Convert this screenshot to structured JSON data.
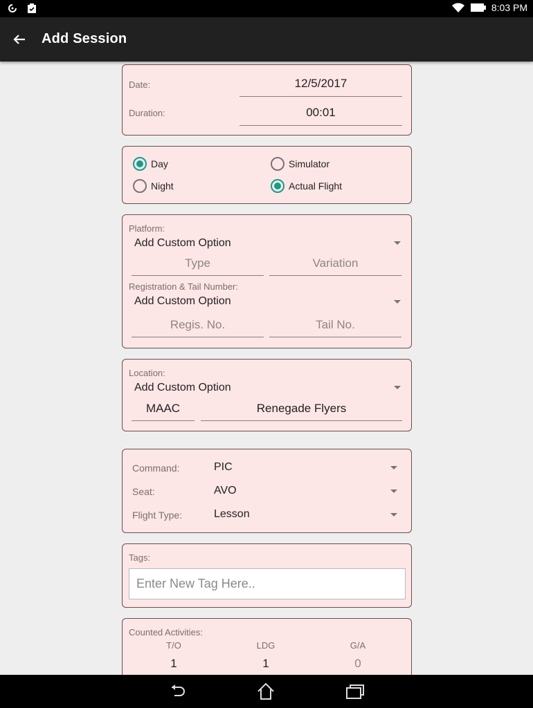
{
  "status_bar": {
    "time": "8:03 PM",
    "left_icons": [
      "sync-icon",
      "clipboard-check-icon"
    ],
    "right_icons": [
      "wifi-icon",
      "battery-icon"
    ]
  },
  "app_bar": {
    "title": "Add Session",
    "back_icon": "arrow-back-icon"
  },
  "date_card": {
    "date_label": "Date:",
    "date_value": "12/5/2017",
    "duration_label": "Duration:",
    "duration_value": "00:01"
  },
  "conditions_card": {
    "radios": [
      {
        "label": "Day",
        "checked": true
      },
      {
        "label": "Simulator",
        "checked": false
      },
      {
        "label": "Night",
        "checked": false
      },
      {
        "label": "Actual Flight",
        "checked": true
      }
    ]
  },
  "platform_card": {
    "platform_label": "Platform:",
    "platform_dropdown": "Add Custom Option",
    "type_placeholder": "Type",
    "variation_placeholder": "Variation",
    "registration_label": "Registration & Tail Number:",
    "registration_dropdown": "Add Custom Option",
    "regis_placeholder": "Regis. No.",
    "tail_placeholder": "Tail No."
  },
  "location_card": {
    "location_label": "Location:",
    "location_dropdown": "Add Custom Option",
    "code_value": "MAAC",
    "name_value": "Renegade Flyers"
  },
  "command_card": {
    "rows": [
      {
        "label": "Command:",
        "value": "PIC"
      },
      {
        "label": "Seat:",
        "value": "AVO"
      },
      {
        "label": "Flight Type:",
        "value": "Lesson"
      }
    ]
  },
  "tags_card": {
    "label": "Tags:",
    "placeholder": "Enter New Tag Here.."
  },
  "activities_card": {
    "label": "Counted Activities:",
    "columns": [
      {
        "header": "T/O",
        "value": "1"
      },
      {
        "header": "LDG",
        "value": "1"
      },
      {
        "header": "G/A",
        "value": "0"
      }
    ]
  },
  "nav_bar": {
    "buttons": [
      "back-nav-icon",
      "home-icon",
      "recents-icon"
    ]
  },
  "colors": {
    "accent": "#129e8c",
    "card_bg": "#fde6e6",
    "card_border": "#6d4c4f",
    "app_bar": "#212121"
  }
}
